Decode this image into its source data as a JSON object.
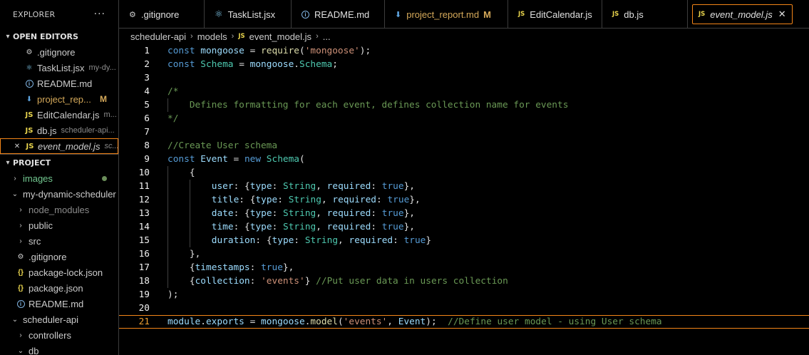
{
  "sidebar": {
    "header": "EXPLORER",
    "more": "···",
    "open_editors_title": "OPEN EDITORS",
    "open_editors": [
      {
        "label": ".gitignore",
        "desc": "",
        "icon": "gear-icon"
      },
      {
        "label": "TaskList.jsx",
        "desc": "my-dy...",
        "icon": "react-icon"
      },
      {
        "label": "README.md",
        "desc": "",
        "icon": "info-icon"
      },
      {
        "label": "project_rep...",
        "desc": "",
        "icon": "download-icon",
        "badge": "M"
      },
      {
        "label": "EditCalendar.js",
        "desc": "m...",
        "icon": "js-icon"
      },
      {
        "label": "db.js",
        "desc": "scheduler-api...",
        "icon": "js-icon"
      },
      {
        "label": "event_model.js",
        "desc": "sc...",
        "icon": "js-icon",
        "active": true
      }
    ],
    "project_title": "PROJECT",
    "project_items": [
      {
        "label": "images",
        "indent": 1
      },
      {
        "label": "my-dynamic-scheduler",
        "indent": 1
      },
      {
        "label": "node_modules",
        "indent": 2
      },
      {
        "label": "public",
        "indent": 2
      },
      {
        "label": "src",
        "indent": 2
      },
      {
        "label": ".gitignore",
        "indent": 2
      },
      {
        "label": "package-lock.json",
        "indent": 2
      },
      {
        "label": "package.json",
        "indent": 2
      },
      {
        "label": "README.md",
        "indent": 2
      },
      {
        "label": "scheduler-api",
        "indent": 1
      },
      {
        "label": "controllers",
        "indent": 2
      },
      {
        "label": "db",
        "indent": 2
      }
    ]
  },
  "tabs": [
    {
      "label": ".gitignore"
    },
    {
      "label": "TaskList.jsx"
    },
    {
      "label": "README.md"
    },
    {
      "label": "project_report.md",
      "badge": "M"
    },
    {
      "label": "EditCalendar.js"
    },
    {
      "label": "db.js"
    },
    {
      "label": "event_model.js",
      "active": true
    }
  ],
  "js_label": "JS",
  "close_glyph": "✕",
  "breadcrumb": [
    "scheduler-api",
    "models",
    "event_model.js",
    "..."
  ],
  "editor": {
    "current_line": 21,
    "lines": [
      "const mongoose = require('mongoose');",
      "const Schema = mongoose.Schema;",
      "",
      "/*",
      "    Defines formatting for each event, defines collection name for events",
      "*/",
      "",
      "//Create User schema",
      "const Event = new Schema(",
      "    {",
      "        user: {type: String, required: true},",
      "        title: {type: String, required: true},",
      "        date: {type: String, required: true},",
      "        time: {type: String, required: true},",
      "        duration: {type: String, required: true}",
      "    },",
      "    {timestamps: true},",
      "    {collection: 'events'} //Put user data in users collection",
      ");",
      "",
      "module.exports = mongoose.model('events', Event);  //Define user model - using User schema"
    ]
  }
}
